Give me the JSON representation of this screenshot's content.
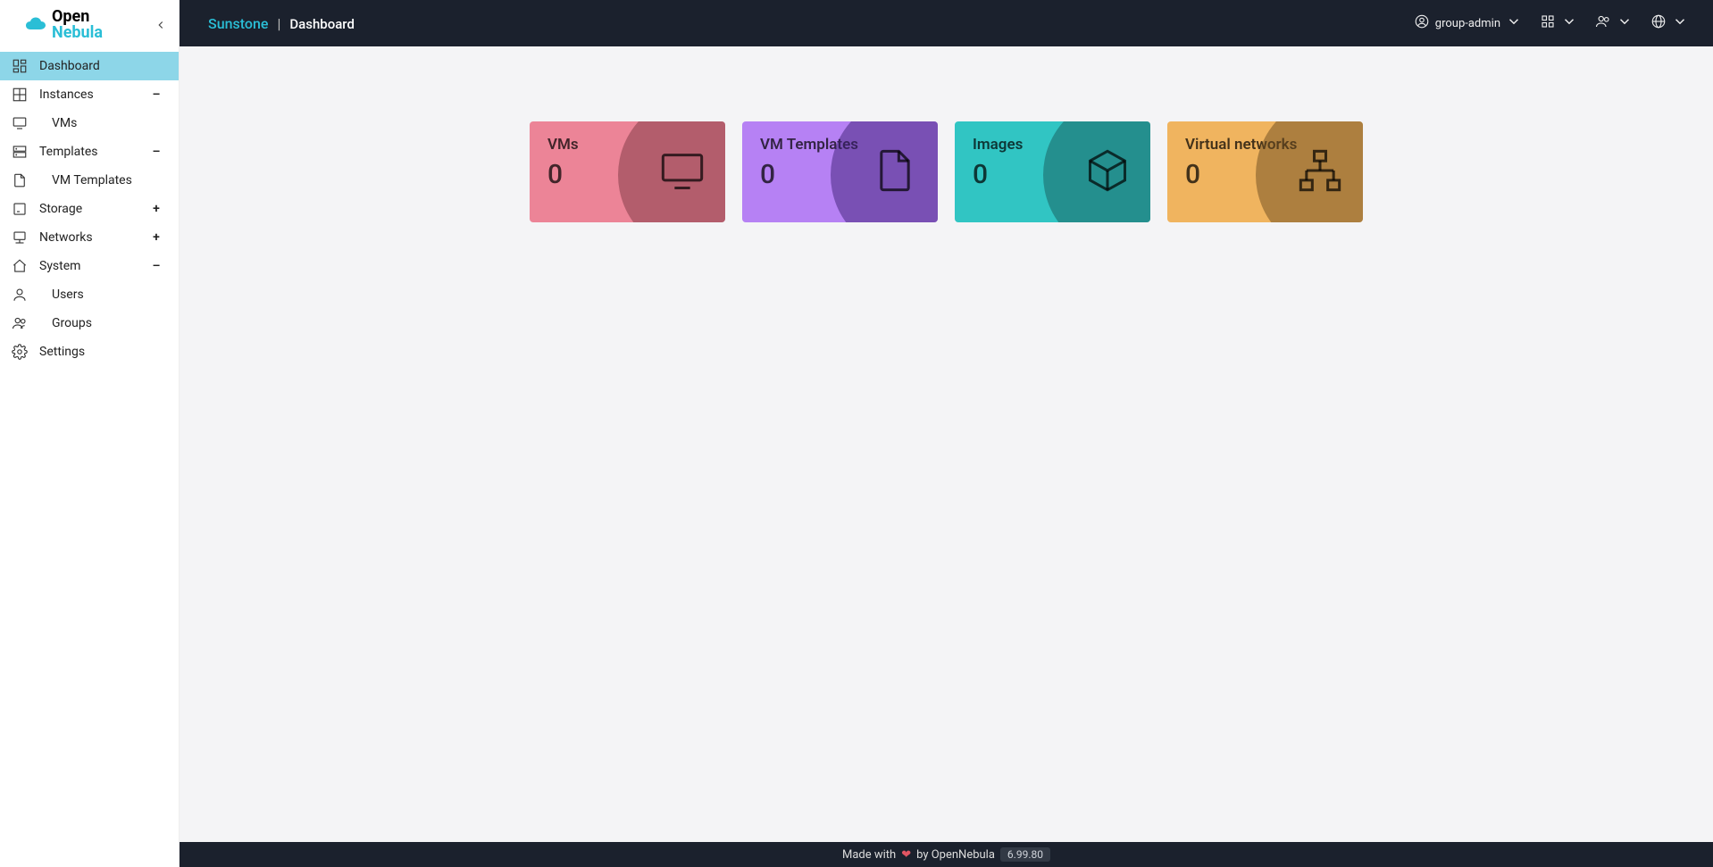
{
  "logo": {
    "line1": "Open",
    "line2": "Nebula"
  },
  "header": {
    "app": "Sunstone",
    "separator": "|",
    "page": "Dashboard",
    "user": "group-admin"
  },
  "sidebar": {
    "dashboard": "Dashboard",
    "instances": "Instances",
    "vms": "VMs",
    "templates": "Templates",
    "vm_templates": "VM Templates",
    "storage": "Storage",
    "networks": "Networks",
    "system": "System",
    "users": "Users",
    "groups": "Groups",
    "settings": "Settings",
    "minus": "–",
    "plus": "+"
  },
  "cards": {
    "vms": {
      "title": "VMs",
      "value": "0"
    },
    "vmt": {
      "title": "VM Templates",
      "value": "0"
    },
    "img": {
      "title": "Images",
      "value": "0"
    },
    "net": {
      "title": "Virtual networks",
      "value": "0"
    }
  },
  "footer": {
    "made": "Made with",
    "by": "by OpenNebula",
    "version": "6.99.80"
  }
}
